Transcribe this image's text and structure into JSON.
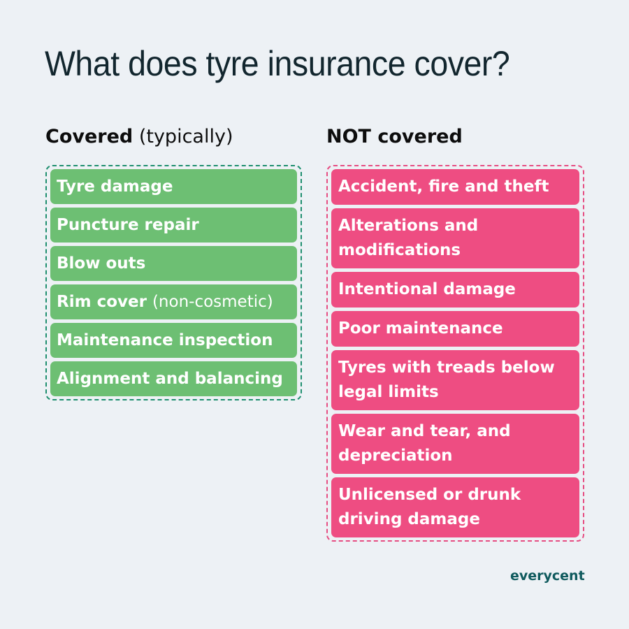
{
  "title": "What does tyre insurance cover?",
  "covered": {
    "heading_bold": "Covered",
    "heading_light": "(typically)",
    "items": [
      {
        "bold": "Tyre damage",
        "light": ""
      },
      {
        "bold": "Puncture repair",
        "light": ""
      },
      {
        "bold": "Blow outs",
        "light": ""
      },
      {
        "bold": "Rim cover",
        "light": "(non-cosmetic)"
      },
      {
        "bold": "Maintenance inspection",
        "light": ""
      },
      {
        "bold": "Alignment and balancing",
        "light": ""
      }
    ]
  },
  "not_covered": {
    "heading_bold": "NOT covered",
    "items": [
      {
        "line1": "Accident, fire and theft",
        "line2": ""
      },
      {
        "line1": "Alterations and",
        "line2": "modifications"
      },
      {
        "line1": "Intentional damage",
        "line2": ""
      },
      {
        "line1": "Poor maintenance",
        "line2": ""
      },
      {
        "line1": "Tyres with treads below",
        "line2": "legal limits"
      },
      {
        "line1": "Wear and tear, and",
        "line2": "depreciation"
      },
      {
        "line1": "Unlicensed or drunk",
        "line2": "driving damage"
      }
    ]
  },
  "brand": "everycent",
  "colors": {
    "covered": "#6dbf73",
    "not_covered": "#ee4d82",
    "brand": "#0f5a5d"
  }
}
